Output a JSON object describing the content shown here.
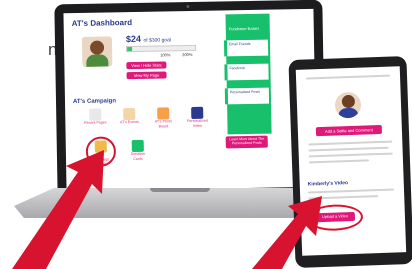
{
  "fragment_text": "n",
  "laptop": {
    "dashboard_title": "AT's Dashboard",
    "goal_amount": "$24",
    "goal_text": "of $300 goal",
    "progress_pct": 8,
    "tick_labels": [
      "100%",
      "200%"
    ],
    "primary_buttons": [
      "View / Hide Stats",
      "View My Page"
    ],
    "campaign_heading": "AT's Campaign",
    "campaign_items": [
      {
        "label": "Recent Pages",
        "color": "#e8e8e8"
      },
      {
        "label": "AT's Events",
        "color": "#f3d6a6"
      },
      {
        "label": "AT's Photo Board",
        "color": "#f6a04a"
      },
      {
        "label": "Personalized Video",
        "color": "#2b3a8c"
      },
      {
        "label": "AT's Campaign Video",
        "color": "#f2b84b"
      },
      {
        "label": "Donation Cards",
        "color": "#18c06b"
      }
    ],
    "sidebar_title": "Fundraise Easier",
    "sidebar_cards": [
      "Email Friends",
      "Facebook",
      "Personalized Posts"
    ],
    "cta_label": "Learn More About The Personalized Posts"
  },
  "tablet": {
    "primary_button": "Add a Selfie and Comment",
    "section_heading": "Kimberly's Video",
    "upload_button": "Upload a Video"
  },
  "colors": {
    "brand_navy": "#2b3a8c",
    "brand_pink": "#e0187a",
    "brand_green": "#18c06b",
    "highlight_red": "#d7132f"
  }
}
